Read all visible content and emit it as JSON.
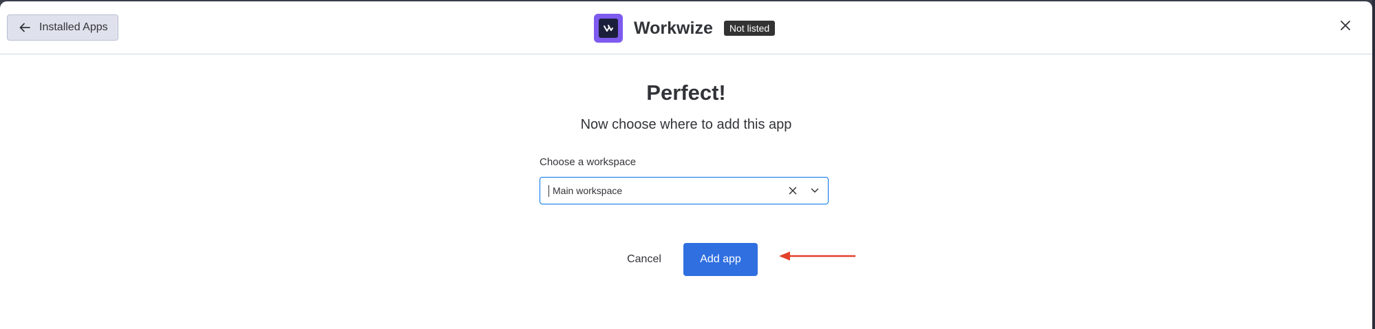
{
  "header": {
    "back_label": "Installed Apps",
    "app_name": "Workwize",
    "badge": "Not listed",
    "icons": {
      "back": "arrow-left-icon",
      "close": "close-icon",
      "logo": "workwize-logo"
    }
  },
  "main": {
    "title": "Perfect!",
    "subtitle": "Now choose where to add this app",
    "workspace_label": "Choose a workspace",
    "workspace_value": "Main workspace",
    "cancel_label": "Cancel",
    "add_label": "Add app"
  },
  "colors": {
    "primary": "#2f6fe0",
    "logo_bg": "#7e5bef",
    "annotation_arrow": "#e2412b",
    "badge_bg": "#333333"
  }
}
